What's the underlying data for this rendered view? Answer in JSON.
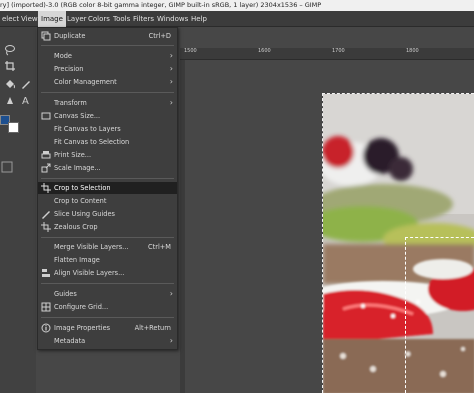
{
  "window": {
    "title": "ry] (imported)-3.0 (RGB color 8-bit gamma integer, GIMP built-in sRGB, 1 layer) 2304x1536 – GIMP"
  },
  "menubar": [
    {
      "label": "elect"
    },
    {
      "label": "View"
    },
    {
      "label": "Image",
      "active": true
    },
    {
      "label": "Layer"
    },
    {
      "label": "Colors"
    },
    {
      "label": "Tools"
    },
    {
      "label": "Filters"
    },
    {
      "label": "Windows"
    },
    {
      "label": "Help"
    }
  ],
  "ruler": {
    "labels": [
      "1500",
      "1600",
      "1700",
      "1800"
    ]
  },
  "image_menu": {
    "items": [
      {
        "label": "Duplicate",
        "shortcut": "Ctrl+D",
        "icon": "duplicate-icon"
      },
      {
        "label": "Mode",
        "submenu": true
      },
      {
        "label": "Precision",
        "submenu": true
      },
      {
        "label": "Color Management",
        "submenu": true
      },
      {
        "label": "Transform",
        "submenu": true
      },
      {
        "label": "Canvas Size...",
        "icon": "canvas-size-icon"
      },
      {
        "label": "Fit Canvas to Layers"
      },
      {
        "label": "Fit Canvas to Selection"
      },
      {
        "label": "Print Size...",
        "icon": "print-size-icon"
      },
      {
        "label": "Scale Image...",
        "icon": "scale-image-icon"
      },
      {
        "label": "Crop to Selection",
        "icon": "crop-selection-icon",
        "highlighted": true
      },
      {
        "label": "Crop to Content"
      },
      {
        "label": "Slice Using Guides",
        "icon": "slice-guides-icon"
      },
      {
        "label": "Zealous Crop",
        "icon": "zealous-crop-icon"
      },
      {
        "label": "Merge Visible Layers...",
        "shortcut": "Ctrl+M"
      },
      {
        "label": "Flatten Image"
      },
      {
        "label": "Align Visible Layers...",
        "icon": "align-layers-icon"
      },
      {
        "label": "Guides",
        "submenu": true
      },
      {
        "label": "Configure Grid...",
        "icon": "grid-icon"
      },
      {
        "label": "Image Properties",
        "shortcut": "Alt+Return",
        "icon": "info-icon"
      },
      {
        "label": "Metadata",
        "submenu": true
      }
    ]
  },
  "colors": {
    "menu_bg": "#3e3e3e",
    "highlight": "#202020",
    "fg_color": "#1d4f8f",
    "bg_color": "#ffffff"
  }
}
